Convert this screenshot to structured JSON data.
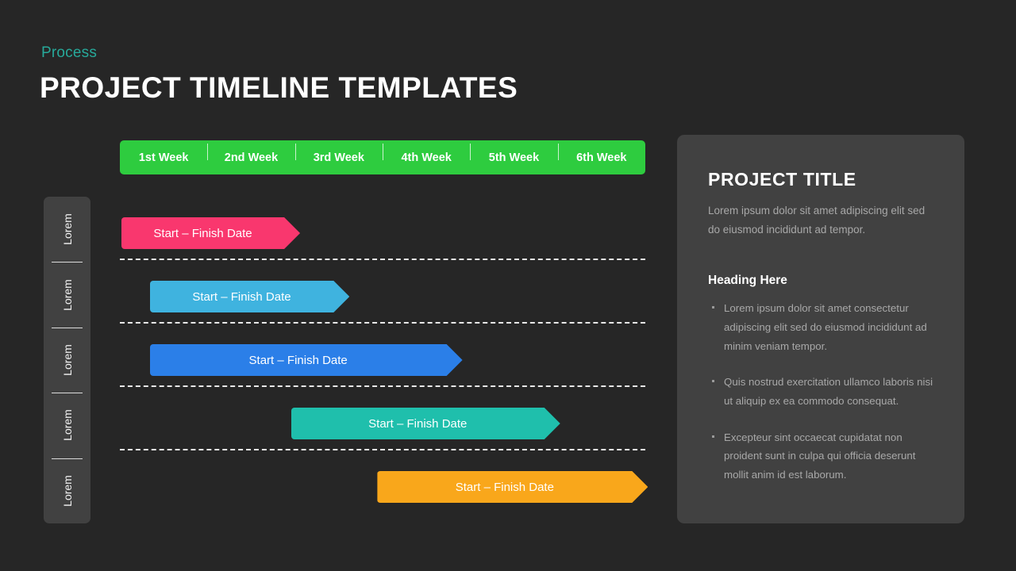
{
  "header": {
    "eyebrow": "Process",
    "eyebrow_color": "#27a99a",
    "title": "PROJECT TIMELINE TEMPLATES"
  },
  "weekbar": {
    "background": "#2ECC3F",
    "weeks": [
      {
        "label": "1st Week"
      },
      {
        "label": "2nd Week"
      },
      {
        "label": "3rd Week"
      },
      {
        "label": "4th Week"
      },
      {
        "label": "5th Week"
      },
      {
        "label": "6th Week"
      }
    ]
  },
  "rail": {
    "items": [
      {
        "label": "Lorem"
      },
      {
        "label": "Lorem"
      },
      {
        "label": "Lorem"
      },
      {
        "label": "Lorem"
      },
      {
        "label": "Lorem"
      }
    ]
  },
  "chart_data": {
    "type": "bar",
    "title": "PROJECT TIMELINE TEMPLATES",
    "xlabel": "",
    "ylabel": "",
    "categories": [
      "Lorem",
      "Lorem",
      "Lorem",
      "Lorem",
      "Lorem"
    ],
    "x_tick_labels": [
      "1st Week",
      "2nd Week",
      "3rd Week",
      "4th Week",
      "5th Week",
      "6th Week"
    ],
    "xlim": [
      0,
      6
    ],
    "grid": false,
    "legend": "none",
    "bars": [
      {
        "label": "Start – Finish Date",
        "color": "#F9376E",
        "start_week": 0.0,
        "end_week": 2.0,
        "left_pct": 0.3,
        "width_pct": 34.0
      },
      {
        "label": "Start – Finish Date",
        "color": "#3FB3DF",
        "start_week": 0.35,
        "end_week": 2.6,
        "left_pct": 5.7,
        "width_pct": 38.0
      },
      {
        "label": "Start – Finish Date",
        "color": "#2B7FE8",
        "start_week": 0.35,
        "end_week": 3.9,
        "left_pct": 5.7,
        "width_pct": 59.5
      },
      {
        "label": "Start – Finish Date",
        "color": "#1FBFAC",
        "start_week": 1.95,
        "end_week": 5.0,
        "left_pct": 32.6,
        "width_pct": 51.2
      },
      {
        "label": "Start – Finish Date",
        "color": "#F9A71B",
        "start_week": 2.95,
        "end_week": 6.0,
        "left_pct": 49.0,
        "width_pct": 51.5
      }
    ]
  },
  "panel": {
    "title": "PROJECT TITLE",
    "subtitle": "Lorem ipsum dolor sit amet adipiscing elit sed do eiusmod incididunt ad tempor.",
    "heading": "Heading Here",
    "bullets": [
      {
        "text": "Lorem ipsum dolor sit amet consectetur adipiscing elit sed do eiusmod incididunt ad minim veniam tempor."
      },
      {
        "text": "Quis nostrud exercitation ullamco laboris nisi ut aliquip ex ea commodo consequat."
      },
      {
        "text": "Excepteur sint occaecat cupidatat non proident sunt in culpa qui officia deserunt mollit anim id est laborum."
      }
    ]
  },
  "theme": {
    "background": "#262626",
    "panel_background": "#414141",
    "separator_color": "#e8e8e8"
  }
}
